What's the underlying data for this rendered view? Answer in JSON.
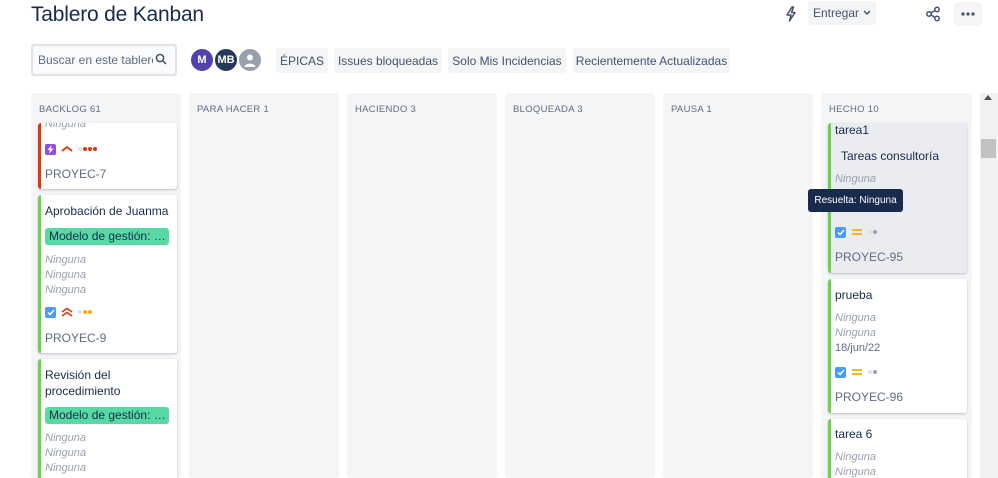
{
  "header": {
    "title": "Tablero de Kanban",
    "deliver_label": "Entregar",
    "icons": {
      "bolt": "bolt-icon",
      "chevron": "chevron-down-icon",
      "share": "share-icon",
      "more": "more-icon"
    }
  },
  "search": {
    "placeholder": "Buscar en este tablero",
    "value": ""
  },
  "avatars": [
    "M",
    "MB",
    ""
  ],
  "filters": [
    "ÉPICAS",
    "Issues bloqueadas",
    "Solo Mis Incidencias",
    "Recientemente Actualizadas"
  ],
  "colors": {
    "epic_green": "#57d9a3",
    "done_green": "#6dd14d",
    "highest_red": "#de350b",
    "checkbox_blue": "#4c9aff",
    "tooltip_bg": "#172b4d"
  },
  "columns": [
    {
      "header": "BACKLOG 61",
      "cards": [
        {
          "field_top": "Ninguna",
          "key": "PROYEC-7",
          "bar_color": "#de350b"
        },
        {
          "summary": "Aprobación de Juanma",
          "epic": "Modelo de gestión: procedimiento",
          "fields": [
            "Ninguna",
            "Ninguna",
            "Ninguna"
          ],
          "key": "PROYEC-9",
          "bar_color": "#6dd14d"
        },
        {
          "summary_line1": "Revisión del",
          "summary_line2": "procedimiento",
          "epic": "Modelo de gestión: procedimiento",
          "fields": [
            "Ninguna",
            "Ninguna",
            "Ninguna"
          ],
          "bar_color": "#6dd14d"
        }
      ]
    },
    {
      "header": "PARA HACER 1",
      "cards": []
    },
    {
      "header": "HACIENDO 3",
      "cards": []
    },
    {
      "header": "BLOQUEADA 3",
      "cards": []
    },
    {
      "header": "PAUSA 1",
      "cards": []
    },
    {
      "header": "HECHO 10",
      "cards": [
        {
          "summary": "tarea1",
          "sub": "Tareas consultoría",
          "fields": [
            "Ninguna"
          ],
          "key": "PROYEC-95",
          "bar_color": "#6dd14d"
        },
        {
          "summary": "prueba",
          "fields": [
            "Ninguna",
            "Ninguna"
          ],
          "date": "18/jun/22",
          "key": "PROYEC-96",
          "bar_color": "#6dd14d"
        },
        {
          "summary": "tarea 6",
          "fields": [
            "Ninguna",
            "Ninguna"
          ],
          "bar_color": "#6dd14d"
        }
      ]
    }
  ],
  "tooltip": "Resuelta: Ninguna"
}
